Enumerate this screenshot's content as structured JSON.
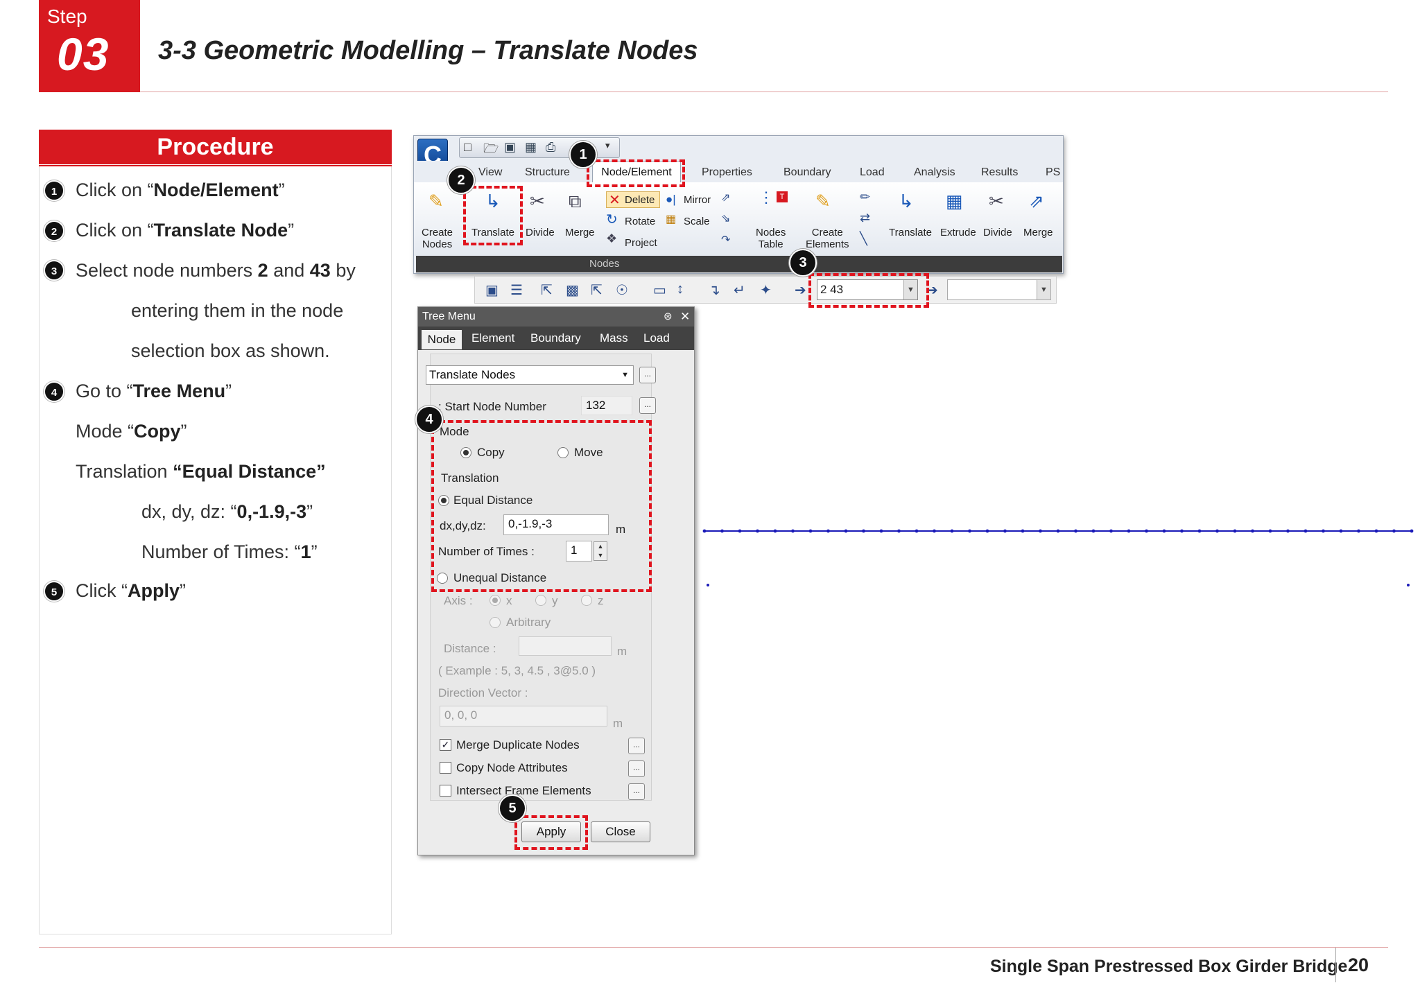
{
  "header": {
    "step_label": "Step",
    "step_number": "03",
    "title": "3-3 Geometric Modelling – Translate Nodes"
  },
  "procedure": {
    "heading": "Procedure",
    "steps": [
      {
        "num": "1",
        "pre": "Click on “",
        "bold": "Node/Element",
        "post": "”"
      },
      {
        "num": "2",
        "pre": "Click on “",
        "bold": "Translate Node",
        "post": "”"
      },
      {
        "num": "3",
        "pre": "Select node numbers ",
        "bold": "2",
        "mid": " and ",
        "bold2": "43",
        "post": " by"
      },
      {
        "num": "4",
        "pre": "Go to “",
        "bold": "Tree Menu",
        "post": "”"
      },
      {
        "num": "5",
        "pre": "Click “",
        "bold": "Apply",
        "post": "”"
      }
    ],
    "step3_line2": "entering them in the node",
    "step3_line3": "selection box as shown.",
    "mode_pre": "Mode “",
    "mode_bold": "Copy",
    "mode_post": "”",
    "trans_pre": "Translation ",
    "trans_bold": "“Equal Distance”",
    "dxyz_pre": "dx, dy, dz: “",
    "dxyz_bold": "0,-1.9,-3",
    "dxyz_post": "”",
    "times_pre": "Number of Times: “",
    "times_bold": "1",
    "times_post": "”"
  },
  "ribbon": {
    "app_letter": "C",
    "tabs": [
      "View",
      "Structure",
      "Node/Element",
      "Properties",
      "Boundary",
      "Load",
      "Analysis",
      "Results",
      "PSC"
    ],
    "active_tab": "Node/Element",
    "buttons": {
      "create_nodes": [
        "Create",
        "Nodes"
      ],
      "translate": "Translate",
      "divide": "Divide",
      "merge": "Merge",
      "delete": "Delete",
      "rotate": "Rotate",
      "project": "Project",
      "mirror": "Mirror",
      "scale": "Scale",
      "nodes_table": [
        "Nodes",
        "Table"
      ],
      "create_elements": [
        "Create",
        "Elements"
      ],
      "el_translate": "Translate",
      "el_extrude": "Extrude",
      "el_divide": "Divide",
      "el_merge": "Merge"
    },
    "group_label": "Nodes"
  },
  "selection_bar": {
    "node_selection": "2 43"
  },
  "tree_menu": {
    "title": "Tree Menu",
    "pin_icon": "pin-icon",
    "close_icon": "close-icon",
    "tabs": [
      "Node",
      "Element",
      "Boundary",
      "Mass",
      "Load"
    ],
    "active_tab": "Node",
    "function": "Translate Nodes",
    "start_node_label": "Start Node Number   :",
    "start_node_value": "132",
    "mode_label": "Mode",
    "mode_copy": "Copy",
    "mode_move": "Move",
    "mode_selected": "Copy",
    "translation_label": "Translation",
    "equal_distance": "Equal Distance",
    "dxdydz_label": "dx,dy,dz:",
    "dxdydz_value": "0,-1.9,-3",
    "unit_m": "m",
    "times_label": "Number of Times :",
    "times_value": "1",
    "unequal_distance": "Unequal Distance",
    "axis_label": "Axis :",
    "axis_x": "x",
    "axis_y": "y",
    "axis_z": "z",
    "arbitrary": "Arbitrary",
    "distance_label": "Distance  :",
    "example": "( Example :   5, 3, 4.5 , 3@5.0 )",
    "direction_label": "Direction Vector :",
    "direction_value": "0, 0, 0",
    "merge_dup": "Merge Duplicate Nodes",
    "copy_attr": "Copy Node Attributes",
    "intersect": "Intersect Frame Elements",
    "merge_dup_checked": true,
    "apply": "Apply",
    "close": "Close",
    "dots": "..."
  },
  "callouts": [
    "1",
    "2",
    "3",
    "4",
    "5"
  ],
  "footer": {
    "title": "Single Span Prestressed Box Girder Bridge",
    "page": "20"
  },
  "colors": {
    "accent": "#d71920",
    "dash": "#e0141e",
    "node_dots": "#1a1ab8"
  }
}
